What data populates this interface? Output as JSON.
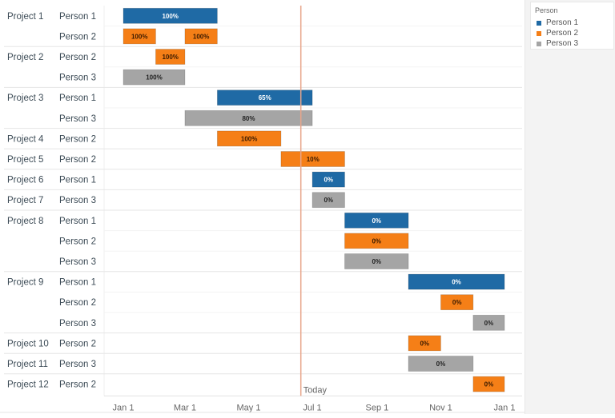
{
  "legend": {
    "title": "Person",
    "items": [
      {
        "label": "Person 1",
        "color": "#1f6aa5"
      },
      {
        "label": "Person 2",
        "color": "#f57f17"
      },
      {
        "label": "Person 3",
        "color": "#a5a5a5"
      }
    ]
  },
  "chart_data": {
    "type": "gantt",
    "title": "",
    "xlabel": "",
    "ylabel": "",
    "x_unit": "day of year",
    "x_range": [
      0,
      365
    ],
    "x_ticks": [
      {
        "label": "Jan 1",
        "day": 0
      },
      {
        "label": "Mar 1",
        "day": 59
      },
      {
        "label": "May 1",
        "day": 120
      },
      {
        "label": "Jul 1",
        "day": 181
      },
      {
        "label": "Sep 1",
        "day": 243
      },
      {
        "label": "Nov 1",
        "day": 304
      },
      {
        "label": "Jan 1",
        "day": 365
      }
    ],
    "today": {
      "label": "Today",
      "day": 170,
      "color": "#e8a58a"
    },
    "person_colors": {
      "Person 1": "#1f6aa5",
      "Person 2": "#f57f17",
      "Person 3": "#a5a5a5"
    },
    "label_colors": {
      "Person 1": "#ffffff",
      "Person 2": "#3a1a00",
      "Person 3": "#222222"
    },
    "rows": [
      {
        "project": "Project 1",
        "person": "Person 1",
        "tasks": [
          {
            "start": 0,
            "end": 89,
            "progress": "100%"
          }
        ]
      },
      {
        "project": "",
        "person": "Person 2",
        "tasks": [
          {
            "start": 0,
            "end": 30,
            "progress": "100%"
          },
          {
            "start": 59,
            "end": 89,
            "progress": "100%"
          }
        ]
      },
      {
        "project": "Project 2",
        "person": "Person 2",
        "tasks": [
          {
            "start": 31,
            "end": 58,
            "progress": "100%"
          }
        ]
      },
      {
        "project": "",
        "person": "Person 3",
        "tasks": [
          {
            "start": 0,
            "end": 58,
            "progress": "100%"
          }
        ]
      },
      {
        "project": "Project 3",
        "person": "Person 1",
        "tasks": [
          {
            "start": 90,
            "end": 180,
            "progress": "65%"
          }
        ]
      },
      {
        "project": "",
        "person": "Person 3",
        "tasks": [
          {
            "start": 59,
            "end": 180,
            "progress": "80%"
          }
        ]
      },
      {
        "project": "Project 4",
        "person": "Person 2",
        "tasks": [
          {
            "start": 90,
            "end": 150,
            "progress": "100%"
          }
        ]
      },
      {
        "project": "Project 5",
        "person": "Person 2",
        "tasks": [
          {
            "start": 151,
            "end": 211,
            "progress": "10%"
          }
        ]
      },
      {
        "project": "Project 6",
        "person": "Person 1",
        "tasks": [
          {
            "start": 181,
            "end": 211,
            "progress": "0%"
          }
        ]
      },
      {
        "project": "Project 7",
        "person": "Person 3",
        "tasks": [
          {
            "start": 181,
            "end": 211,
            "progress": "0%"
          }
        ]
      },
      {
        "project": "Project 8",
        "person": "Person 1",
        "tasks": [
          {
            "start": 212,
            "end": 272,
            "progress": "0%"
          }
        ]
      },
      {
        "project": "",
        "person": "Person 2",
        "tasks": [
          {
            "start": 212,
            "end": 272,
            "progress": "0%"
          }
        ]
      },
      {
        "project": "",
        "person": "Person 3",
        "tasks": [
          {
            "start": 212,
            "end": 272,
            "progress": "0%"
          }
        ]
      },
      {
        "project": "Project 9",
        "person": "Person 1",
        "tasks": [
          {
            "start": 273,
            "end": 364,
            "progress": "0%"
          }
        ]
      },
      {
        "project": "",
        "person": "Person 2",
        "tasks": [
          {
            "start": 304,
            "end": 334,
            "progress": "0%"
          }
        ]
      },
      {
        "project": "",
        "person": "Person 3",
        "tasks": [
          {
            "start": 335,
            "end": 364,
            "progress": "0%"
          }
        ]
      },
      {
        "project": "Project 10",
        "person": "Person 2",
        "tasks": [
          {
            "start": 273,
            "end": 303,
            "progress": "0%"
          }
        ]
      },
      {
        "project": "Project 11",
        "person": "Person 3",
        "tasks": [
          {
            "start": 273,
            "end": 334,
            "progress": "0%"
          }
        ]
      },
      {
        "project": "Project 12",
        "person": "Person 2",
        "tasks": [
          {
            "start": 335,
            "end": 364,
            "progress": "0%"
          }
        ]
      }
    ]
  }
}
